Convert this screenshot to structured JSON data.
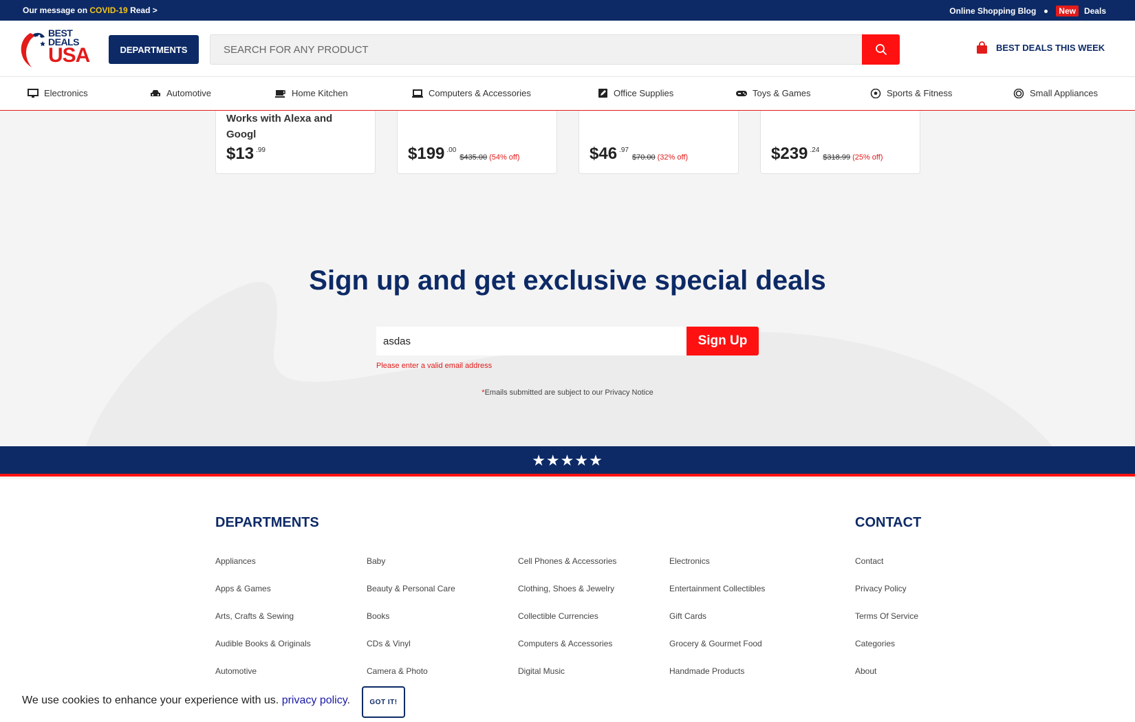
{
  "topbar": {
    "message_prefix": "Our message on",
    "covid": "COVID-19",
    "read": "Read >",
    "blog": "Online Shopping Blog",
    "new_badge": "New",
    "deals": "Deals"
  },
  "header": {
    "logo_line1": "BEST",
    "logo_line2": "DEALS",
    "logo_line3": "USA",
    "departments_button": "DEPARTMENTS",
    "search_placeholder": "SEARCH FOR ANY PRODUCT",
    "best_deals_link": "BEST DEALS THIS WEEK"
  },
  "categories": [
    {
      "label": "Electronics",
      "icon": "monitor-icon"
    },
    {
      "label": "Automotive",
      "icon": "car-icon"
    },
    {
      "label": "Home Kitchen",
      "icon": "coffee-cup-icon"
    },
    {
      "label": "Computers & Accessories",
      "icon": "laptop-icon"
    },
    {
      "label": "Office Supplies",
      "icon": "edit-square-icon"
    },
    {
      "label": "Toys & Games",
      "icon": "gamepad-icon"
    },
    {
      "label": "Sports & Fitness",
      "icon": "soccer-ball-icon"
    },
    {
      "label": "Small Appliances",
      "icon": "target-icon"
    }
  ],
  "products": [
    {
      "title": "Works with Alexa and Googl",
      "dollars": "$13",
      "cents": ".99",
      "old_price": "",
      "discount": ""
    },
    {
      "title": "",
      "dollars": "$199",
      "cents": ".00",
      "old_price": "$435.00",
      "discount": "(54% off)"
    },
    {
      "title": "",
      "dollars": "$46",
      "cents": ".97",
      "old_price": "$70.00",
      "discount": "(32% off)"
    },
    {
      "title": "",
      "dollars": "$239",
      "cents": ".24",
      "old_price": "$318.99",
      "discount": "(25% off)"
    }
  ],
  "signup": {
    "title": "Sign up and get exclusive special deals",
    "email_value": "asdas",
    "button": "Sign Up",
    "error": "Please enter a valid email address",
    "privacy_star": "*",
    "privacy_note": "Emails submitted are subject to our Privacy Notice"
  },
  "stars": "★★★★★",
  "footer": {
    "departments_heading": "DEPARTMENTS",
    "contact_heading": "CONTACT",
    "columns": [
      [
        "Appliances",
        "Apps & Games",
        "Arts, Crafts & Sewing",
        "Audible Books & Originals",
        "Automotive"
      ],
      [
        "Baby",
        "Beauty & Personal Care",
        "Books",
        "CDs & Vinyl",
        "Camera & Photo"
      ],
      [
        "Cell Phones & Accessories",
        "Clothing, Shoes & Jewelry",
        "Collectible Currencies",
        "Computers & Accessories",
        "Digital Music"
      ],
      [
        "Electronics",
        "Entertainment Collectibles",
        "Gift Cards",
        "Grocery & Gourmet Food",
        "Handmade Products"
      ]
    ],
    "contact_links": [
      "Contact",
      "Privacy Policy",
      "Terms Of Service",
      "Categories",
      "About"
    ]
  },
  "cookie": {
    "message": "We use cookies to enhance your experience with us.",
    "link": "privacy policy",
    "period": ".",
    "button": "GOT IT!"
  },
  "colors": {
    "navy": "#0d2a66",
    "red": "#ff1111",
    "yellow": "#f5c518"
  }
}
